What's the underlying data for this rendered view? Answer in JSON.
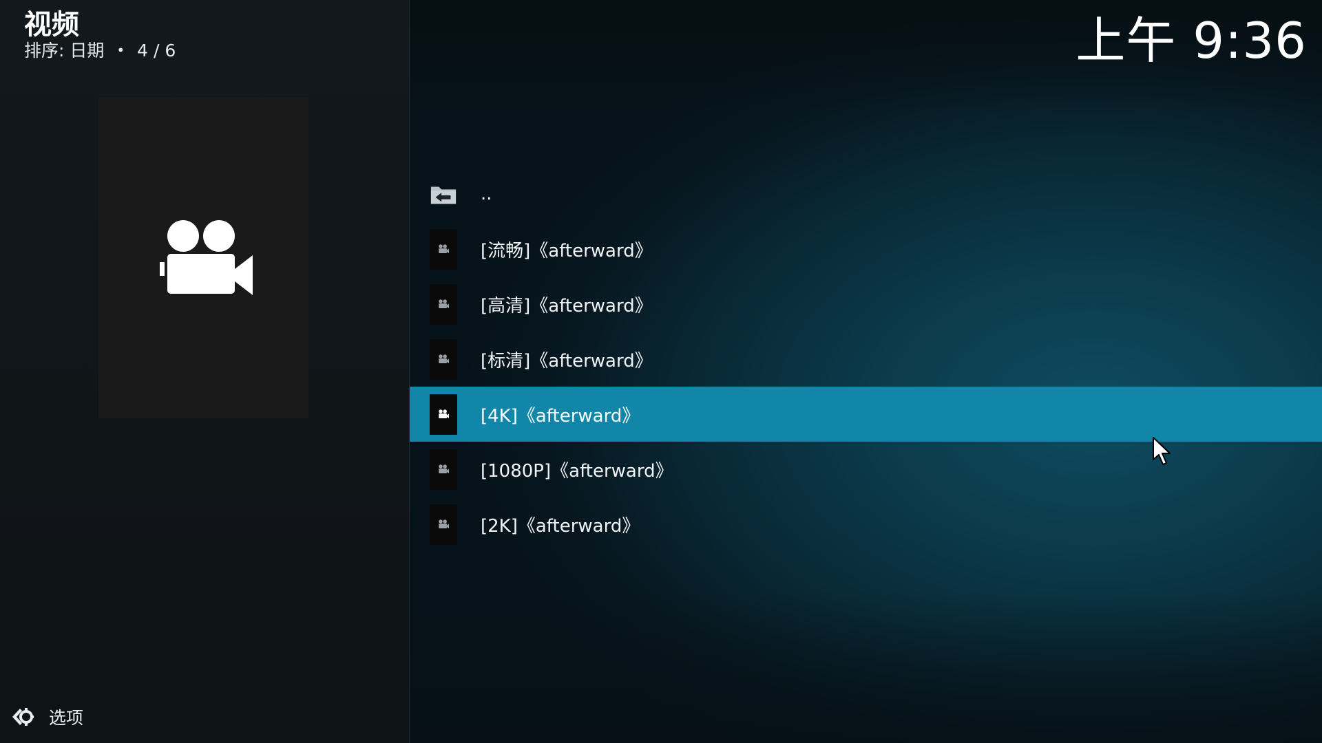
{
  "header": {
    "title": "视频",
    "sort_label": "排序: 日期",
    "separator": "•",
    "position": "4 / 6"
  },
  "clock": "上午 9:36",
  "list": {
    "selected_index": 4,
    "items": [
      {
        "label": "..",
        "icon": "folder-back-icon"
      },
      {
        "label": "[流畅]《afterward》",
        "icon": "video-camera-icon"
      },
      {
        "label": "[高清]《afterward》",
        "icon": "video-camera-icon"
      },
      {
        "label": "[标清]《afterward》",
        "icon": "video-camera-icon"
      },
      {
        "label": "[4K]《afterward》",
        "icon": "video-camera-icon"
      },
      {
        "label": "[1080P]《afterward》",
        "icon": "video-camera-icon"
      },
      {
        "label": "[2K]《afterward》",
        "icon": "video-camera-icon"
      }
    ]
  },
  "poster": {
    "icon": "video-camera-icon"
  },
  "options": {
    "label": "选项",
    "icon": "options-gear-icon"
  },
  "colors": {
    "selected_row": "#1186a8",
    "left_panel": "#12181c",
    "right_panel": "#0b3a4b"
  }
}
